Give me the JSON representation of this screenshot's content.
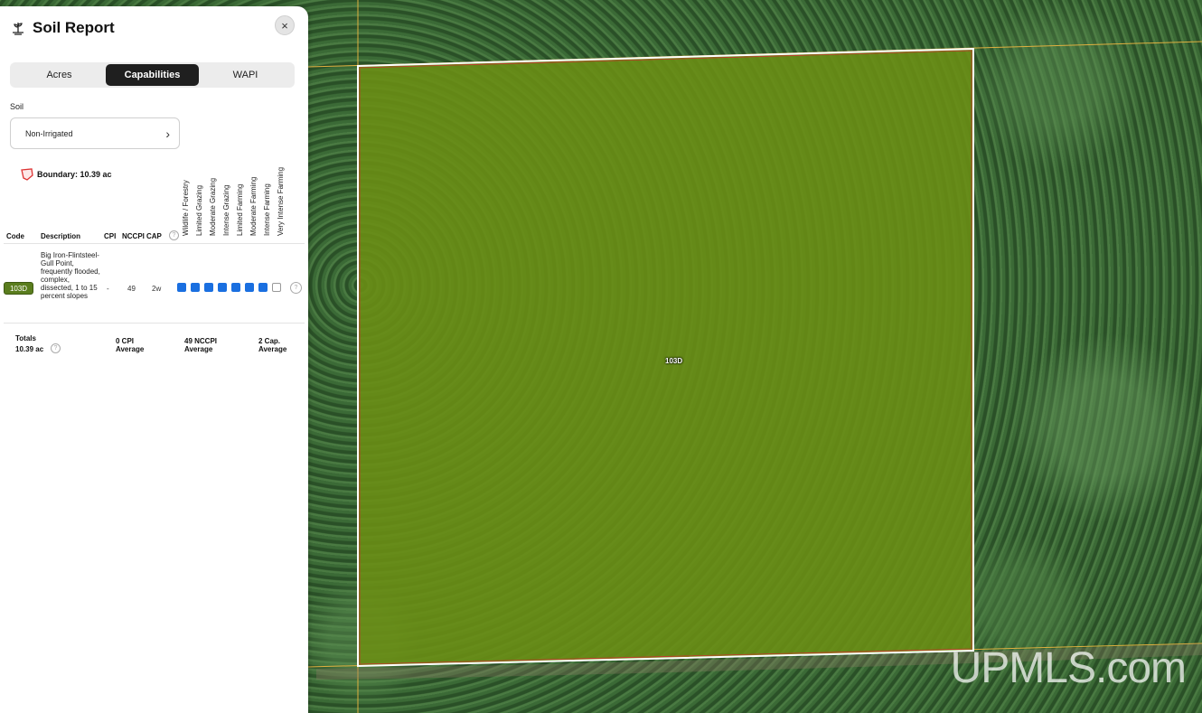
{
  "panel": {
    "title": "Soil Report",
    "close_icon": "×",
    "tabs": [
      {
        "label": "Acres",
        "active": false
      },
      {
        "label": "Capabilities",
        "active": true
      },
      {
        "label": "WAPI",
        "active": false
      }
    ],
    "soil_label": "Soil",
    "soil_select": {
      "value": "Non-Irrigated",
      "chevron": "›"
    },
    "boundary_text": "Boundary: 10.39 ac",
    "capability_headers": [
      "Wildlife / Forestry",
      "Limited Grazing",
      "Moderate Grazing",
      "Intense Grazing",
      "Limited Farming",
      "Moderate Farming",
      "Intense Farming",
      "Very Intense Farming"
    ],
    "columns": {
      "code": "Code",
      "description": "Description",
      "cpi": "CPI",
      "nccpi": "NCCPI",
      "cap": "CAP",
      "help": "?"
    },
    "row": {
      "code": "103D",
      "description": "Big Iron-Flintsteel-Gull Point, frequently flooded, complex, dissected, 1 to 15 percent slopes",
      "cpi": "-",
      "nccpi": "49",
      "cap": "2w",
      "capability_level": 7,
      "help": "?"
    },
    "totals": {
      "label": "Totals",
      "acres": "10.39 ac",
      "help": "?",
      "cpi_value": "0 CPI",
      "cpi_sub": "Average",
      "nccpi_value": "49 NCCPI",
      "nccpi_sub": "Average",
      "cap_value": "2 Cap.",
      "cap_sub": "Average"
    }
  },
  "map": {
    "parcel_label": "103D",
    "watermark": "UPMLS.com",
    "parcel_fill": "#6b8e14",
    "boundary_color": "#ffffff"
  },
  "colors": {
    "accent": "#1f1f1f",
    "capability_on": "#1a6fe0",
    "code_badge": "#5a7d1e"
  }
}
